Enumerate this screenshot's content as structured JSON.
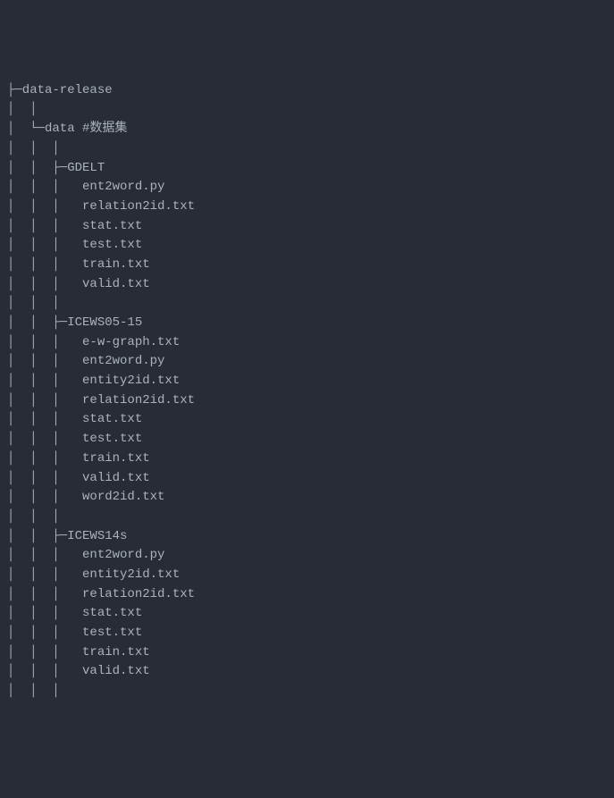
{
  "tree": {
    "root": "data-release",
    "data_folder": "data",
    "data_comment": "#数据集",
    "folders": [
      {
        "name": "GDELT",
        "files": [
          "ent2word.py",
          "relation2id.txt",
          "stat.txt",
          "test.txt",
          "train.txt",
          "valid.txt"
        ]
      },
      {
        "name": "ICEWS05-15",
        "files": [
          "e-w-graph.txt",
          "ent2word.py",
          "entity2id.txt",
          "relation2id.txt",
          "stat.txt",
          "test.txt",
          "train.txt",
          "valid.txt",
          "word2id.txt"
        ]
      },
      {
        "name": "ICEWS14s",
        "files": [
          "ent2word.py",
          "entity2id.txt",
          "relation2id.txt",
          "stat.txt",
          "test.txt",
          "train.txt",
          "valid.txt"
        ]
      }
    ]
  }
}
